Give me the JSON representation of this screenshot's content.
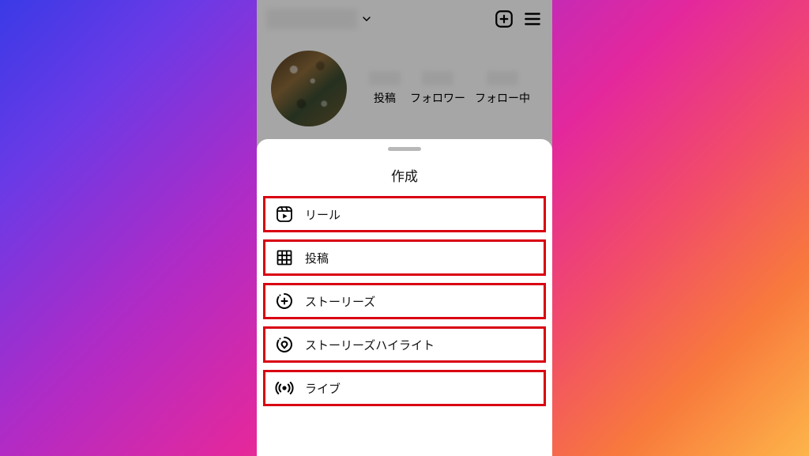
{
  "header": {
    "add_icon": "add",
    "menu_icon": "menu"
  },
  "stats": {
    "posts_label": "投稿",
    "followers_label": "フォロワー",
    "following_label": "フォロー中"
  },
  "sheet": {
    "title": "作成",
    "options": [
      {
        "icon": "reel",
        "label": "リール"
      },
      {
        "icon": "grid",
        "label": "投稿"
      },
      {
        "icon": "story",
        "label": "ストーリーズ"
      },
      {
        "icon": "highlight",
        "label": "ストーリーズハイライト"
      },
      {
        "icon": "live",
        "label": "ライブ"
      }
    ]
  },
  "colors": {
    "highlight_border": "#d90012"
  }
}
